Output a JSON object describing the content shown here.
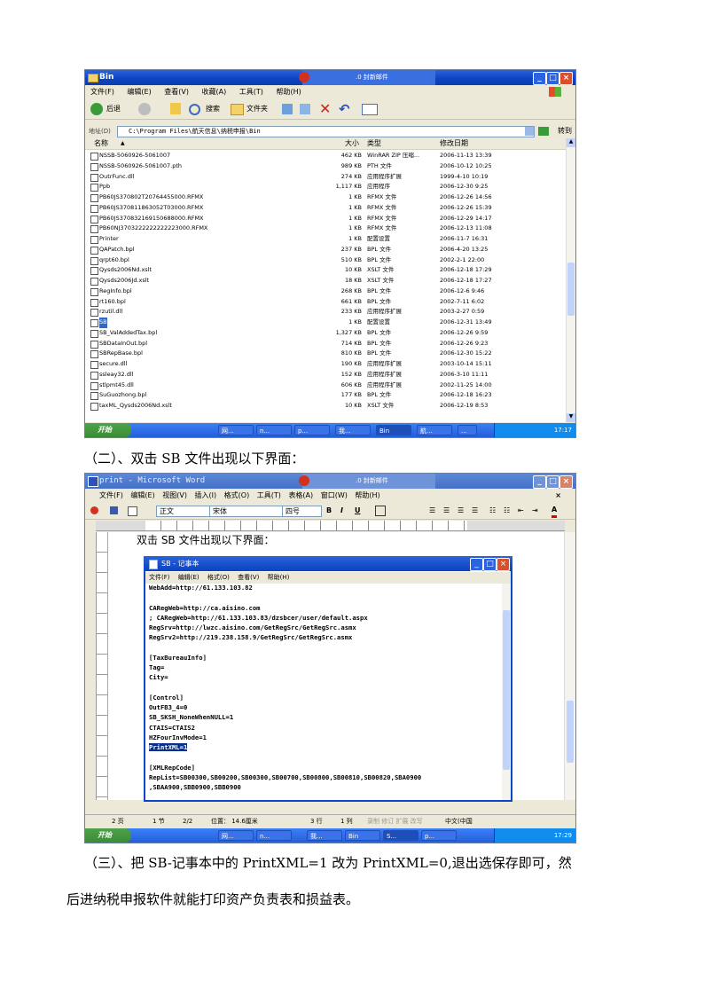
{
  "explorer": {
    "title": "Bin",
    "overlay_title": ".0 封新邮件",
    "menu": [
      "文件(F)",
      "编辑(E)",
      "查看(V)",
      "收藏(A)",
      "工具(T)",
      "帮助(H)"
    ],
    "toolbar": {
      "back": "后退",
      "search": "搜索",
      "folders": "文件夹"
    },
    "address_label": "地址(D)",
    "address": "C:\\Program Files\\航天信息\\纳税申报\\Bin",
    "go": "转到",
    "columns": [
      "名称",
      "大小",
      "类型",
      "修改日期"
    ],
    "files": [
      {
        "name": "NSSB-5060926-5061007",
        "size": "462 KB",
        "type": "WinRAR ZIP 压缩...",
        "date": "2006-11-13 13:39"
      },
      {
        "name": "NSSB-5060926-5061007.pth",
        "size": "989 KB",
        "type": "PTH 文件",
        "date": "2006-10-12 10:25"
      },
      {
        "name": "OutrFunc.dll",
        "size": "274 KB",
        "type": "应用程序扩展",
        "date": "1999-4-10 10:19"
      },
      {
        "name": "Ppb",
        "size": "1,117 KB",
        "type": "应用程序",
        "date": "2006-12-30 9:25"
      },
      {
        "name": "PB60JS370802T20764455000.RFMX",
        "size": "1 KB",
        "type": "RFMX 文件",
        "date": "2006-12-26 14:56"
      },
      {
        "name": "PB60JS370811863052T03000.RFMX",
        "size": "1 KB",
        "type": "RFMX 文件",
        "date": "2006-12-26 15:39"
      },
      {
        "name": "PB60JS370832169150688000.RFMX",
        "size": "1 KB",
        "type": "RFMX 文件",
        "date": "2006-12-29 14:17"
      },
      {
        "name": "PB60NJ3703222222222223000.RFMX",
        "size": "1 KB",
        "type": "RFMX 文件",
        "date": "2006-12-13 11:08"
      },
      {
        "name": "Printer",
        "size": "1 KB",
        "type": "配置设置",
        "date": "2006-11-7 16:31"
      },
      {
        "name": "QAPatch.bpl",
        "size": "237 KB",
        "type": "BPL 文件",
        "date": "2006-4-20 13:25"
      },
      {
        "name": "qrpt60.bpl",
        "size": "510 KB",
        "type": "BPL 文件",
        "date": "2002-2-1 22:00"
      },
      {
        "name": "Qysds2006Nd.xslt",
        "size": "10 KB",
        "type": "XSLT 文件",
        "date": "2006-12-18 17:29"
      },
      {
        "name": "Qysds2006Jd.xslt",
        "size": "18 KB",
        "type": "XSLT 文件",
        "date": "2006-12-18 17:27"
      },
      {
        "name": "RegInfo.bpl",
        "size": "268 KB",
        "type": "BPL 文件",
        "date": "2006-12-6 9:46"
      },
      {
        "name": "rt160.bpl",
        "size": "661 KB",
        "type": "BPL 文件",
        "date": "2002-7-11 6:02"
      },
      {
        "name": "rzutil.dll",
        "size": "233 KB",
        "type": "应用程序扩展",
        "date": "2003-2-27 0:59"
      },
      {
        "name": "SB",
        "size": "1 KB",
        "type": "配置设置",
        "date": "2006-12-31 13:49",
        "selected": true
      },
      {
        "name": "SB_ValAddedTax.bpl",
        "size": "1,327 KB",
        "type": "BPL 文件",
        "date": "2006-12-26 9:59"
      },
      {
        "name": "SBDataInOut.bpl",
        "size": "714 KB",
        "type": "BPL 文件",
        "date": "2006-12-26 9:23"
      },
      {
        "name": "SBRepBase.bpl",
        "size": "810 KB",
        "type": "BPL 文件",
        "date": "2006-12-30 15:22"
      },
      {
        "name": "secure.dll",
        "size": "190 KB",
        "type": "应用程序扩展",
        "date": "2003-10-14 15:11"
      },
      {
        "name": "ssleay32.dll",
        "size": "152 KB",
        "type": "应用程序扩展",
        "date": "2006-3-10 11:11"
      },
      {
        "name": "stlpmt45.dll",
        "size": "606 KB",
        "type": "应用程序扩展",
        "date": "2002-11-25 14:00"
      },
      {
        "name": "SuGuozhong.bpl",
        "size": "177 KB",
        "type": "BPL 文件",
        "date": "2006-12-18 16:23"
      },
      {
        "name": "taxML_Qysds2006Nd.xslt",
        "size": "10 KB",
        "type": "XSLT 文件",
        "date": "2006-12-19 8:53"
      }
    ],
    "taskbar": {
      "start": "开始",
      "items": [
        "网...",
        "n...",
        "p...",
        "我...",
        "Bin",
        "航...",
        "..."
      ],
      "time": "17:17"
    }
  },
  "caption1": "（二）、双击 SB 文件出现以下界面：",
  "word": {
    "title": "print - Microsoft Word",
    "overlay_title": ".0 封新邮件",
    "menu": [
      "文件(F)",
      "编辑(E)",
      "视图(V)",
      "插入(I)",
      "格式(O)",
      "工具(T)",
      "表格(A)",
      "窗口(W)",
      "帮助(H)"
    ],
    "style": "正文",
    "font": "宋体",
    "size": "四号",
    "doc_text": "双击 SB 文件出现以下界面：",
    "status": {
      "page": "2 页",
      "section": "1 节",
      "pages": "2/2",
      "pos": "位置： 14.6厘米",
      "line": "3 行",
      "col": "1 列",
      "modes": "录制 修订 扩展 改写",
      "lang": "中文(中国"
    },
    "taskbar": {
      "start": "开始",
      "items": [
        "网...",
        "n...",
        "我...",
        "Bin",
        "S...",
        "p..."
      ],
      "time": "17:29"
    }
  },
  "notepad": {
    "title": "SB - 记事本",
    "menu": [
      "文件(F)",
      "编辑(E)",
      "格式(O)",
      "查看(V)",
      "帮助(H)"
    ],
    "lines": [
      "WebAdd=http://61.133.103.82",
      "",
      "CARegWeb=http://ca.aisino.com",
      "; CARegWeb=http://61.133.103.83/dzsbcer/user/default.aspx",
      "RegSrv=http://lwzc.aisino.com/GetRegSrc/GetRegSrc.asmx",
      "RegSrv2=http://219.238.158.9/GetRegSrc/GetRegSrc.asmx",
      "",
      "[TaxBureauInfo]",
      "Tag=",
      "City=",
      "",
      "[Control]",
      "OutFB3_4=0",
      "SB_SKSH_NoneWhenNULL=1",
      "CTAIS=CTAIS2",
      "HZFourInvMode=1",
      "PrintXML=1",
      "",
      "[XMLRepCode]",
      "RepList=SB00300,SB00200,SB00300,SB00700,SB00800,SB00810,SB00820,SBA0900",
      ",SBAA900,SBB0900,SBB0900"
    ],
    "highlight_line": "PrintXML=1"
  },
  "caption2": "（三）、把 SB-记事本中的 PrintXML=1 改为 PrintXML=0,退出选保存即可，然",
  "caption3": "后进纳税申报软件就能打印资产负责表和损益表。"
}
